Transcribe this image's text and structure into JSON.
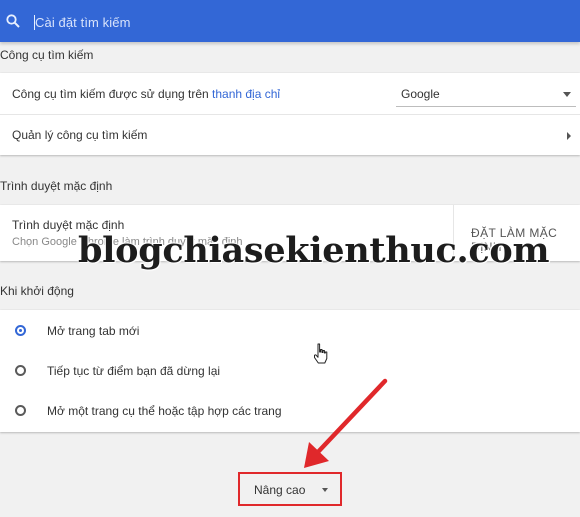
{
  "search": {
    "placeholder": "Cài đặt tìm kiếm"
  },
  "search_engine": {
    "section_title": "Công cụ tìm kiếm",
    "engine_label_prefix": "Công cụ tìm kiếm được sử dụng trên ",
    "engine_label_link": "thanh địa chỉ",
    "engine_value": "Google",
    "manage_label": "Quản lý công cụ tìm kiếm"
  },
  "default_browser": {
    "section_title": "Trình duyệt mặc định",
    "title": "Trình duyệt mặc định",
    "subtitle": "Chọn Google Chrome làm trình duyệt mặc định",
    "button": "ĐẶT LÀM MẶC ĐỊNH"
  },
  "on_startup": {
    "section_title": "Khi khởi động",
    "options": [
      {
        "label": "Mở trang tab mới",
        "checked": true
      },
      {
        "label": "Tiếp tục từ điểm bạn đã dừng lại",
        "checked": false
      },
      {
        "label": "Mở một trang cụ thể hoặc tập hợp các trang",
        "checked": false
      }
    ]
  },
  "advanced": {
    "label": "Nâng cao"
  },
  "watermark": "blogchiasekienthuc.com",
  "colors": {
    "accent": "#3367d6",
    "highlight": "#e0282b",
    "background": "#f1f1f1"
  }
}
